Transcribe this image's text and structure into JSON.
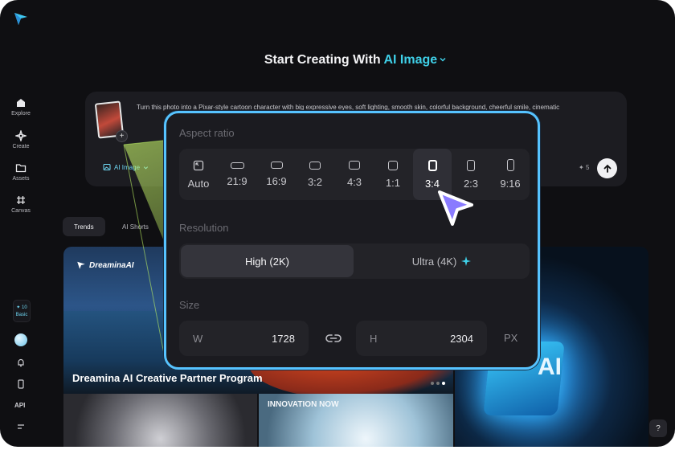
{
  "sidebar": {
    "items": [
      {
        "label": "Explore",
        "icon": "home-icon"
      },
      {
        "label": "Create",
        "icon": "sparkle-icon"
      },
      {
        "label": "Assets",
        "icon": "folder-icon"
      },
      {
        "label": "Canvas",
        "icon": "hash-icon"
      }
    ],
    "credits": {
      "value": "10",
      "plan": "Basic"
    },
    "api_label": "API"
  },
  "heading": {
    "prefix": "Start Creating With",
    "mode": "AI Image"
  },
  "prompt": {
    "text": "Turn this photo into a Pixar-style cartoon character with big expressive eyes, soft lighting, smooth skin, colorful background, cheerful smile, cinematic",
    "mode_label": "AI Image",
    "credit_cost": "5"
  },
  "tabs": [
    {
      "label": "Trends"
    },
    {
      "label": "AI Shorts"
    }
  ],
  "gallery": {
    "brand": "DreaminaAI",
    "hero_title": "Dreamina AI Creative Partner Program",
    "tile_b_text": "INNOVATION NOW",
    "tile_c_text": "AI"
  },
  "popover": {
    "aspect_label": "Aspect ratio",
    "aspect_options": [
      "Auto",
      "21:9",
      "16:9",
      "3:2",
      "4:3",
      "1:1",
      "3:4",
      "2:3",
      "9:16"
    ],
    "aspect_selected": "3:4",
    "resolution_label": "Resolution",
    "resolution_high": "High (2K)",
    "resolution_ultra": "Ultra (4K)",
    "size_label": "Size",
    "width_label": "W",
    "width_value": "1728",
    "height_label": "H",
    "height_value": "2304",
    "unit": "PX"
  },
  "colors": {
    "accent": "#3fd0e8",
    "popover_border": "#56c3ff",
    "cursor": "#8a7bff"
  }
}
